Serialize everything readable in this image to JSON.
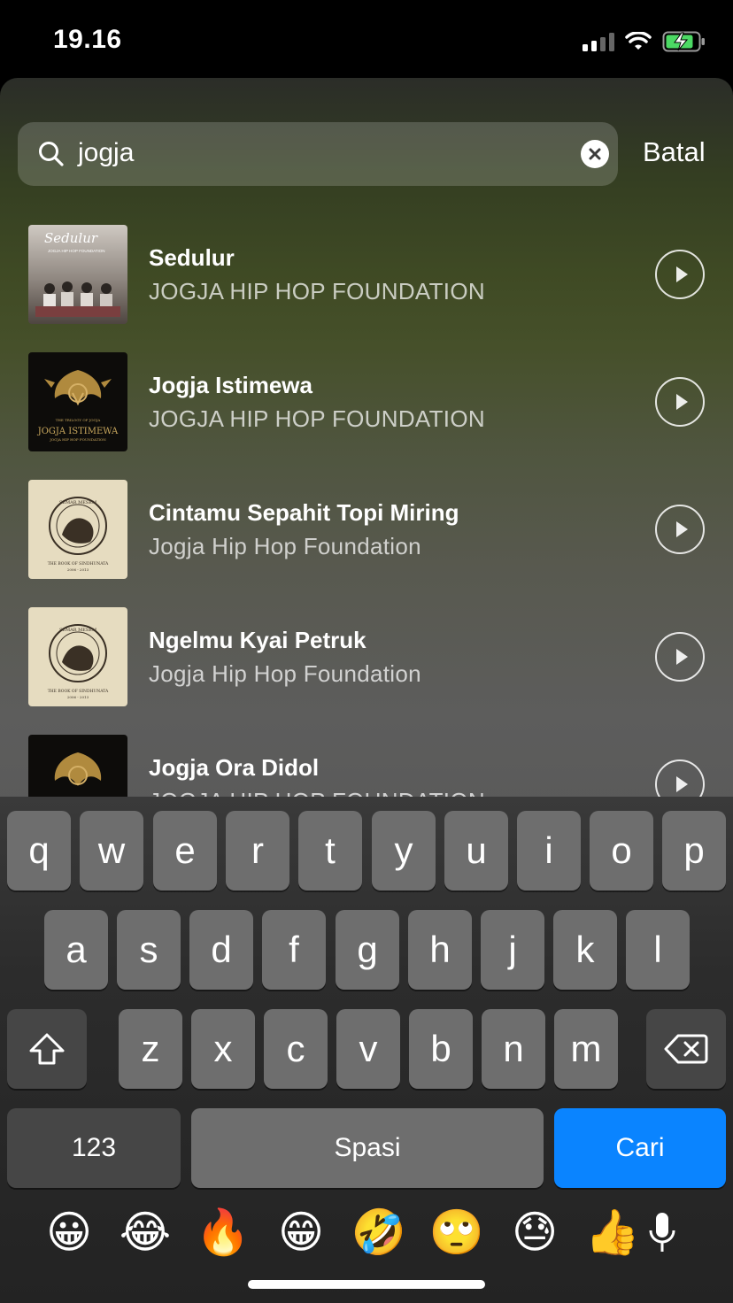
{
  "status": {
    "time": "19.16"
  },
  "search": {
    "query": "jogja",
    "cancel_label": "Batal"
  },
  "results": [
    {
      "title": "Sedulur",
      "artist": "JOGJA HIP HOP FOUNDATION",
      "cover_title": "Sedulur",
      "cover_sub": "JOGJA HIP HOP FOUNDATION"
    },
    {
      "title": "Jogja Istimewa",
      "artist": "JOGJA HIP HOP FOUNDATION",
      "cover_small": "THE TRILOGY OF JOGJA",
      "cover_title": "JOGJA ISTIMEWA",
      "cover_sub": "JOGJA HIP HOP FOUNDATION"
    },
    {
      "title": "Cintamu Sepahit Topi Miring",
      "artist": "Jogja Hip Hop Foundation",
      "cover_top": "SEMAR MESEM",
      "cover_title": "THE BOOK OF SINDHUNATA",
      "cover_sub": "2006 - 2013"
    },
    {
      "title": "Ngelmu Kyai Petruk",
      "artist": "Jogja Hip Hop Foundation",
      "cover_top": "SEMAR MESEM",
      "cover_title": "THE BOOK OF SINDHUNATA",
      "cover_sub": "2006 - 2013"
    },
    {
      "title": "Jogja Ora Didol",
      "artist": "JOGJA HIP HOP FOUNDATION"
    }
  ],
  "keyboard": {
    "row1": [
      "q",
      "w",
      "e",
      "r",
      "t",
      "y",
      "u",
      "i",
      "o",
      "p"
    ],
    "row2": [
      "a",
      "s",
      "d",
      "f",
      "g",
      "h",
      "j",
      "k",
      "l"
    ],
    "row3": [
      "z",
      "x",
      "c",
      "v",
      "b",
      "n",
      "m"
    ],
    "numbers_label": "123",
    "space_label": "Spasi",
    "return_label": "Cari"
  },
  "emoji_bar": [
    "😀",
    "😂",
    "🔥",
    "😁",
    "🤣",
    "🙄",
    "😓",
    "👍"
  ],
  "icons": [
    "signal-icon",
    "wifi-icon",
    "battery-charging-icon",
    "search-icon",
    "clear-icon",
    "play-icon",
    "shift-icon",
    "delete-icon",
    "microphone-icon"
  ],
  "colors": {
    "accent": "#0a84ff",
    "battery": "#4cd964"
  }
}
